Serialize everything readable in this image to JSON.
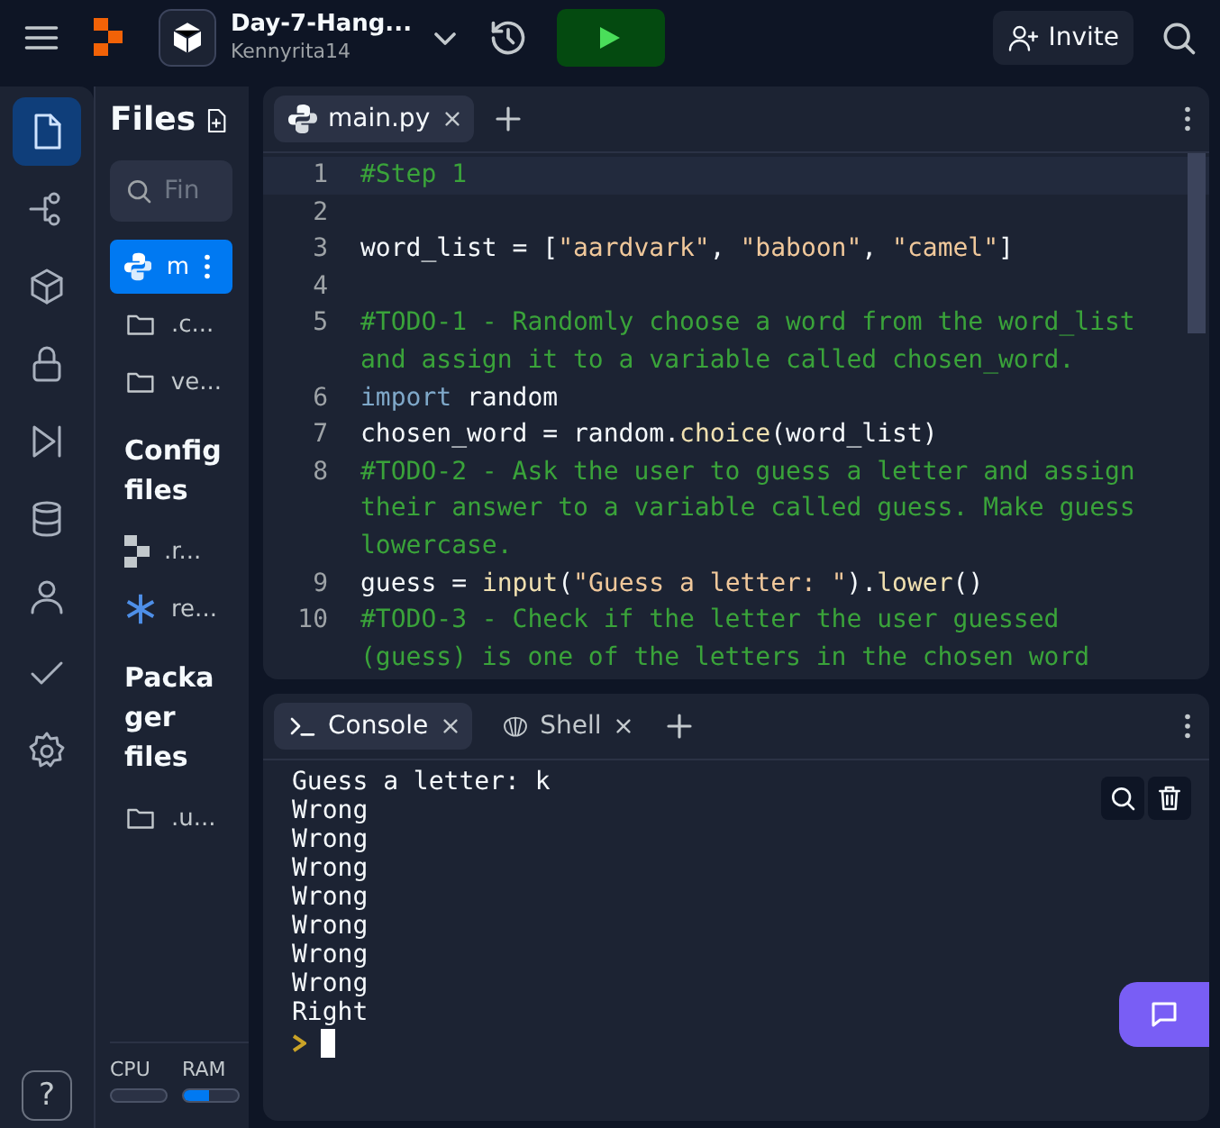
{
  "top_bar": {
    "repl_title": "Day-7-Hang...",
    "owner": "Kennyrita14",
    "invite_label": "Invite"
  },
  "activity_bar": {
    "items": [
      {
        "kind": "files",
        "selected": true
      },
      {
        "kind": "git",
        "selected": false
      },
      {
        "kind": "packages",
        "selected": false
      },
      {
        "kind": "secrets",
        "selected": false
      },
      {
        "kind": "debugger",
        "selected": false
      },
      {
        "kind": "database",
        "selected": false
      },
      {
        "kind": "user",
        "selected": false
      },
      {
        "kind": "check",
        "selected": false
      },
      {
        "kind": "settings",
        "selected": false
      }
    ],
    "help_label": "?"
  },
  "files_panel": {
    "title": "Files",
    "search": {
      "placeholder": "Fin"
    },
    "sections": [
      {
        "items": [
          {
            "name": "m",
            "kind": "python",
            "selected": true
          },
          {
            "name": ".c...",
            "kind": "folder",
            "selected": false
          },
          {
            "name": "ve...",
            "kind": "folder",
            "selected": false
          }
        ]
      },
      {
        "heading": "Config files",
        "items": [
          {
            "name": ".r...",
            "kind": "replit",
            "selected": false
          },
          {
            "name": "re...",
            "kind": "nix",
            "selected": false
          }
        ]
      },
      {
        "heading": "Packager files",
        "items": [
          {
            "name": ".u...",
            "kind": "folder",
            "selected": false
          }
        ]
      }
    ],
    "meters": [
      {
        "label": "CPU",
        "level": 0.0
      },
      {
        "label": "RAM",
        "level": 0.45
      }
    ]
  },
  "editor": {
    "tabs": [
      {
        "label": "main.py",
        "selected": true
      }
    ],
    "lines": [
      {
        "number": "1",
        "rows": [
          [
            {
              "kind": "comment",
              "text": "#Step 1"
            }
          ]
        ]
      },
      {
        "number": "2",
        "rows": [
          []
        ]
      },
      {
        "number": "3",
        "rows": [
          [
            {
              "kind": "plain",
              "text": "word_list = ["
            },
            {
              "kind": "string",
              "text": "\"aardvark\""
            },
            {
              "kind": "plain",
              "text": ", "
            },
            {
              "kind": "string",
              "text": "\"baboon\""
            },
            {
              "kind": "plain",
              "text": ", "
            },
            {
              "kind": "string",
              "text": "\"camel\""
            },
            {
              "kind": "plain",
              "text": "]"
            }
          ]
        ]
      },
      {
        "number": "4",
        "rows": [
          []
        ]
      },
      {
        "number": "5",
        "rows": [
          [
            {
              "kind": "comment",
              "text": "#TODO-1 - Randomly choose a word from the word_list"
            }
          ],
          [
            {
              "kind": "comment",
              "text": "and assign it to a variable called chosen_word."
            }
          ]
        ]
      },
      {
        "number": "6",
        "rows": [
          [
            {
              "kind": "keyword",
              "text": "import"
            },
            {
              "kind": "plain",
              "text": " random"
            }
          ]
        ]
      },
      {
        "number": "7",
        "rows": [
          [
            {
              "kind": "plain",
              "text": "chosen_word = random."
            },
            {
              "kind": "function",
              "text": "choice"
            },
            {
              "kind": "plain",
              "text": "(word_list)"
            }
          ]
        ]
      },
      {
        "number": "8",
        "rows": [
          [
            {
              "kind": "comment",
              "text": "#TODO-2 - Ask the user to guess a letter and assign"
            }
          ],
          [
            {
              "kind": "comment",
              "text": "their answer to a variable called guess. Make guess"
            }
          ],
          [
            {
              "kind": "comment",
              "text": "lowercase."
            }
          ]
        ]
      },
      {
        "number": "9",
        "rows": [
          [
            {
              "kind": "plain",
              "text": "guess = "
            },
            {
              "kind": "function",
              "text": "input"
            },
            {
              "kind": "plain",
              "text": "("
            },
            {
              "kind": "string",
              "text": "\"Guess a letter: \""
            },
            {
              "kind": "plain",
              "text": ")."
            },
            {
              "kind": "function",
              "text": "lower"
            },
            {
              "kind": "plain",
              "text": "()"
            }
          ]
        ]
      },
      {
        "number": "10",
        "rows": [
          [
            {
              "kind": "comment",
              "text": "#TODO-3 - Check if the letter the user guessed"
            }
          ],
          [
            {
              "kind": "comment",
              "text": "(guess) is one of the letters in the chosen word"
            }
          ]
        ]
      }
    ]
  },
  "console": {
    "tabs": [
      {
        "label": "Console",
        "kind": "console",
        "selected": true
      },
      {
        "label": "Shell",
        "kind": "shell",
        "selected": false
      }
    ],
    "output": [
      "Guess a letter: k",
      "Wrong",
      "Wrong",
      "Wrong",
      "Wrong",
      "Wrong",
      "Wrong",
      "Wrong",
      "Right"
    ]
  }
}
